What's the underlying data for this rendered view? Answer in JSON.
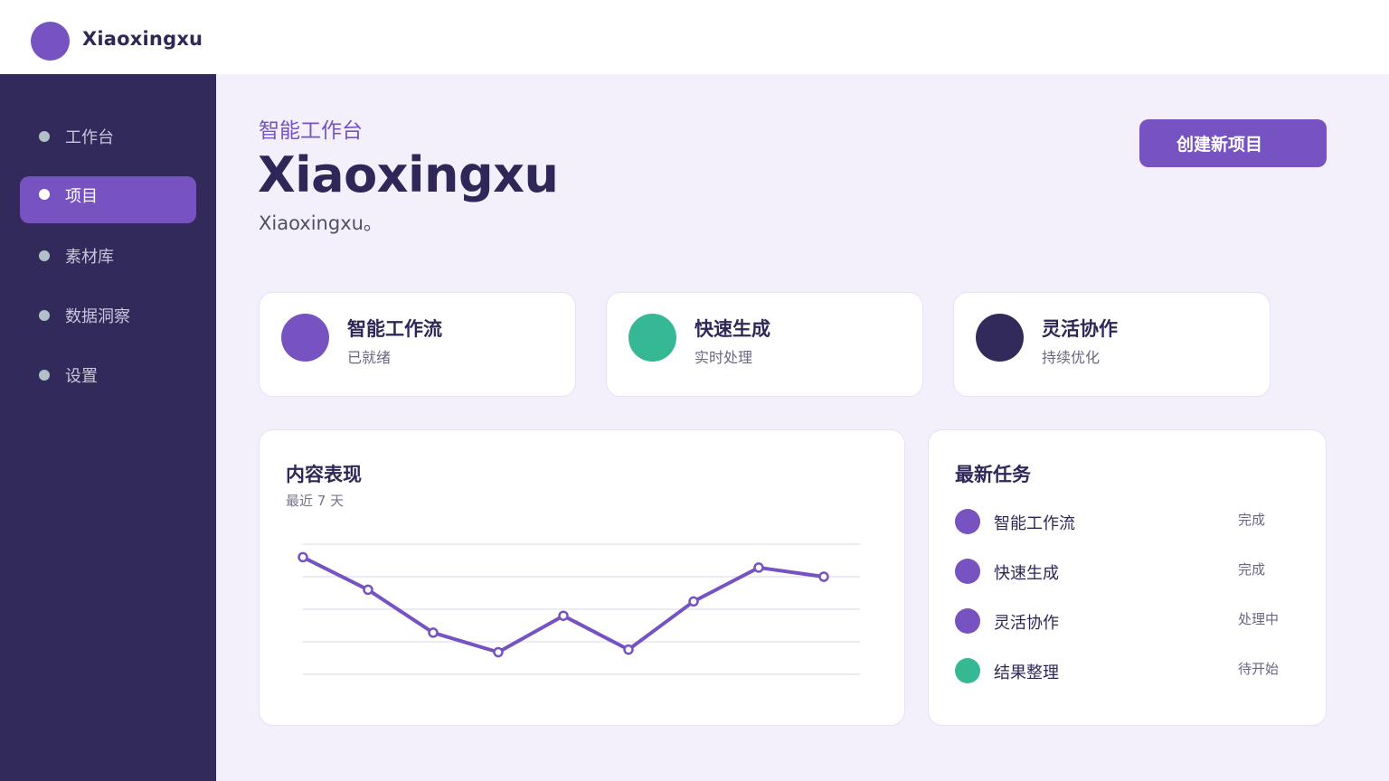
{
  "app": {
    "brand": "Xiaoxingxu",
    "accent": "#7653c1",
    "green": "#37b895",
    "dark": "#332a5c"
  },
  "sidebar": {
    "items": [
      {
        "label": "工作台",
        "active": false
      },
      {
        "label": "项目",
        "active": true
      },
      {
        "label": "素材库",
        "active": false
      },
      {
        "label": "数据洞察",
        "active": false
      },
      {
        "label": "设置",
        "active": false
      }
    ]
  },
  "header": {
    "eyebrow": "智能工作台",
    "title": "Xiaoxingxu",
    "subtitle": "Xiaoxingxu。",
    "create_button": "创建新项目"
  },
  "stats": [
    {
      "title": "智能工作流",
      "subtitle": "已就绪",
      "color": "#7653c1"
    },
    {
      "title": "快速生成",
      "subtitle": "实时处理",
      "color": "#37b895"
    },
    {
      "title": "灵活协作",
      "subtitle": "持续优化",
      "color": "#332a5c"
    }
  ],
  "performance": {
    "title": "内容表现",
    "subtitle": "最近 7 天"
  },
  "chart_data": {
    "type": "line",
    "title": "",
    "xlabel": "",
    "ylabel": "",
    "grid": true,
    "legend": "none",
    "ylim": [
      0,
      100
    ],
    "series": [
      {
        "values": [
          90,
          65,
          32,
          17,
          45,
          19,
          56,
          82,
          75
        ]
      }
    ]
  },
  "tasks": {
    "title": "最新任务",
    "items": [
      {
        "label": "智能工作流",
        "status": "完成",
        "color": "#7653c1"
      },
      {
        "label": "快速生成",
        "status": "完成",
        "color": "#7653c1"
      },
      {
        "label": "灵活协作",
        "status": "处理中",
        "color": "#7653c1"
      },
      {
        "label": "结果整理",
        "status": "待开始",
        "color": "#37b895"
      }
    ]
  }
}
